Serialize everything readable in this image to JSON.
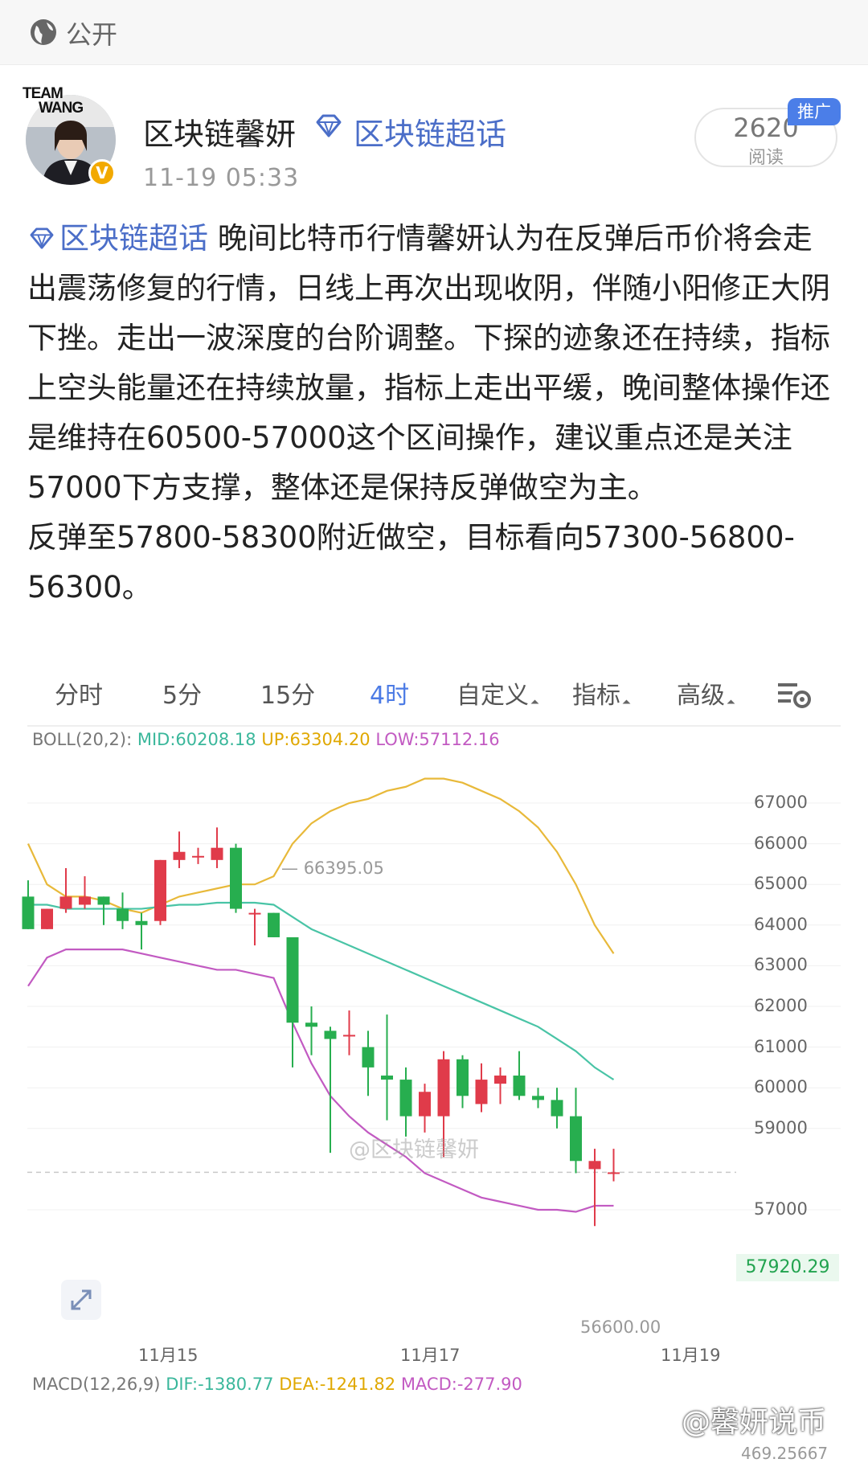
{
  "header": {
    "visibility": "公开",
    "visibility_icon": "globe-icon"
  },
  "author": {
    "name": "区块链馨妍",
    "avatar_text_line1": "TEAM",
    "avatar_text_line2": "WANG",
    "verified_mark": "V",
    "topic": "区块链超话",
    "timestamp": "11-19 05:33",
    "read_count": "2620",
    "read_label": "阅读",
    "promo_badge": "推广"
  },
  "post": {
    "tag": "区块链超话",
    "body1": " 晚间比特币行情馨妍认为在反弹后币价将会走出震荡修复的行情，日线上再次出现收阴，伴随小阳修正大阴下挫。走出一波深度的台阶调整。下探的迹象还在持续，指标上空头能量还在持续放量，指标上走出平缓，晚间整体操作还是维持在60500-57000这个区间操作，建议重点还是关注57000下方支撑，整体还是保持反弹做空为主。",
    "body2": "反弹至57800-58300附近做空，目标看向57300-56800-56300。"
  },
  "tabs": [
    "分时",
    "5分",
    "15分",
    "4时",
    "自定义",
    "指标",
    "高级"
  ],
  "active_tab": "4时",
  "legend": {
    "boll_name": "BOLL(20,2):",
    "mid": "MID:60208.18",
    "up": "UP:63304.20",
    "low": "LOW:57112.16",
    "macd_name": "MACD(12,26,9)",
    "dif": "DIF:-1380.77",
    "dea": "DEA:-1241.82",
    "macd": "MACD:-277.90"
  },
  "colors": {
    "up": "#e03b4a",
    "down": "#27ae4f",
    "boll_up": "#e8b93a",
    "boll_mid": "#49c4a6",
    "boll_low": "#c25ac2",
    "accent": "#4c7be5"
  },
  "annotations": {
    "high": "66395.05",
    "low": "56600.00",
    "last_price": "57920.29"
  },
  "watermarks": {
    "center": "@区块链馨妍",
    "corner": "@馨妍说币",
    "bottom_fragment": "469.25667"
  },
  "chart_data": {
    "type": "candlestick",
    "yticks": [
      67000,
      66000,
      65000,
      64000,
      63000,
      62000,
      61000,
      60000,
      59000,
      57000
    ],
    "ytick_labels": [
      "67000",
      "66000",
      "65000",
      "64000",
      "63000",
      "62000",
      "61000",
      "60000",
      "59000",
      "57000"
    ],
    "ylim": [
      56300,
      67800
    ],
    "xticks": [
      "11月15",
      "11月17",
      "11月19"
    ],
    "candles": [
      {
        "o": 64700,
        "h": 65100,
        "l": 63900,
        "c": 63900
      },
      {
        "o": 63900,
        "h": 64400,
        "l": 63900,
        "c": 64400
      },
      {
        "o": 64400,
        "h": 65400,
        "l": 64300,
        "c": 64700
      },
      {
        "o": 64500,
        "h": 65200,
        "l": 64400,
        "c": 64700
      },
      {
        "o": 64700,
        "h": 64700,
        "l": 64000,
        "c": 64500
      },
      {
        "o": 64400,
        "h": 64800,
        "l": 63900,
        "c": 64100
      },
      {
        "o": 64100,
        "h": 64300,
        "l": 63400,
        "c": 64000
      },
      {
        "o": 64100,
        "h": 65600,
        "l": 64000,
        "c": 65600
      },
      {
        "o": 65600,
        "h": 66300,
        "l": 65400,
        "c": 65800
      },
      {
        "o": 65700,
        "h": 65900,
        "l": 65500,
        "c": 65700
      },
      {
        "o": 65600,
        "h": 66400,
        "l": 65400,
        "c": 65900
      },
      {
        "o": 65900,
        "h": 66000,
        "l": 64300,
        "c": 64400
      },
      {
        "o": 64300,
        "h": 64400,
        "l": 63500,
        "c": 64300
      },
      {
        "o": 64300,
        "h": 64300,
        "l": 63700,
        "c": 63700
      },
      {
        "o": 63700,
        "h": 63700,
        "l": 60500,
        "c": 61600
      },
      {
        "o": 61600,
        "h": 62000,
        "l": 60800,
        "c": 61500
      },
      {
        "o": 61400,
        "h": 61500,
        "l": 58400,
        "c": 61200
      },
      {
        "o": 61300,
        "h": 61900,
        "l": 60800,
        "c": 61300
      },
      {
        "o": 61000,
        "h": 61400,
        "l": 59800,
        "c": 60500
      },
      {
        "o": 60300,
        "h": 61800,
        "l": 59200,
        "c": 60200
      },
      {
        "o": 60200,
        "h": 60500,
        "l": 58800,
        "c": 59300
      },
      {
        "o": 59300,
        "h": 60100,
        "l": 58900,
        "c": 59900
      },
      {
        "o": 59300,
        "h": 60900,
        "l": 58300,
        "c": 60700
      },
      {
        "o": 60700,
        "h": 60800,
        "l": 59500,
        "c": 59800
      },
      {
        "o": 59600,
        "h": 60600,
        "l": 59400,
        "c": 60200
      },
      {
        "o": 60100,
        "h": 60500,
        "l": 59600,
        "c": 60300
      },
      {
        "o": 60300,
        "h": 60900,
        "l": 59700,
        "c": 59800
      },
      {
        "o": 59800,
        "h": 60000,
        "l": 59500,
        "c": 59700
      },
      {
        "o": 59700,
        "h": 60000,
        "l": 59000,
        "c": 59300
      },
      {
        "o": 59300,
        "h": 60000,
        "l": 57900,
        "c": 58200
      },
      {
        "o": 58000,
        "h": 58500,
        "l": 56600,
        "c": 58200
      },
      {
        "o": 57900,
        "h": 58500,
        "l": 57700,
        "c": 57920.29
      }
    ],
    "boll_up": [
      66000,
      65000,
      64700,
      64700,
      64600,
      64400,
      64300,
      64500,
      64700,
      64800,
      64900,
      65000,
      65000,
      65200,
      66000,
      66500,
      66800,
      67000,
      67100,
      67300,
      67400,
      67600,
      67600,
      67500,
      67300,
      67100,
      66800,
      66400,
      65800,
      65000,
      64000,
      63300
    ],
    "boll_mid": [
      64500,
      64500,
      64400,
      64400,
      64400,
      64400,
      64400,
      64450,
      64500,
      64500,
      64550,
      64550,
      64550,
      64500,
      64200,
      63900,
      63700,
      63500,
      63300,
      63100,
      62900,
      62700,
      62500,
      62300,
      62100,
      61900,
      61700,
      61500,
      61200,
      60900,
      60500,
      60200
    ],
    "boll_low": [
      62500,
      63200,
      63400,
      63400,
      63400,
      63400,
      63300,
      63200,
      63100,
      63000,
      62900,
      62900,
      62800,
      62700,
      61600,
      60600,
      59800,
      59300,
      58900,
      58600,
      58300,
      57900,
      57700,
      57500,
      57300,
      57200,
      57100,
      57000,
      57000,
      56950,
      57100,
      57100
    ]
  }
}
